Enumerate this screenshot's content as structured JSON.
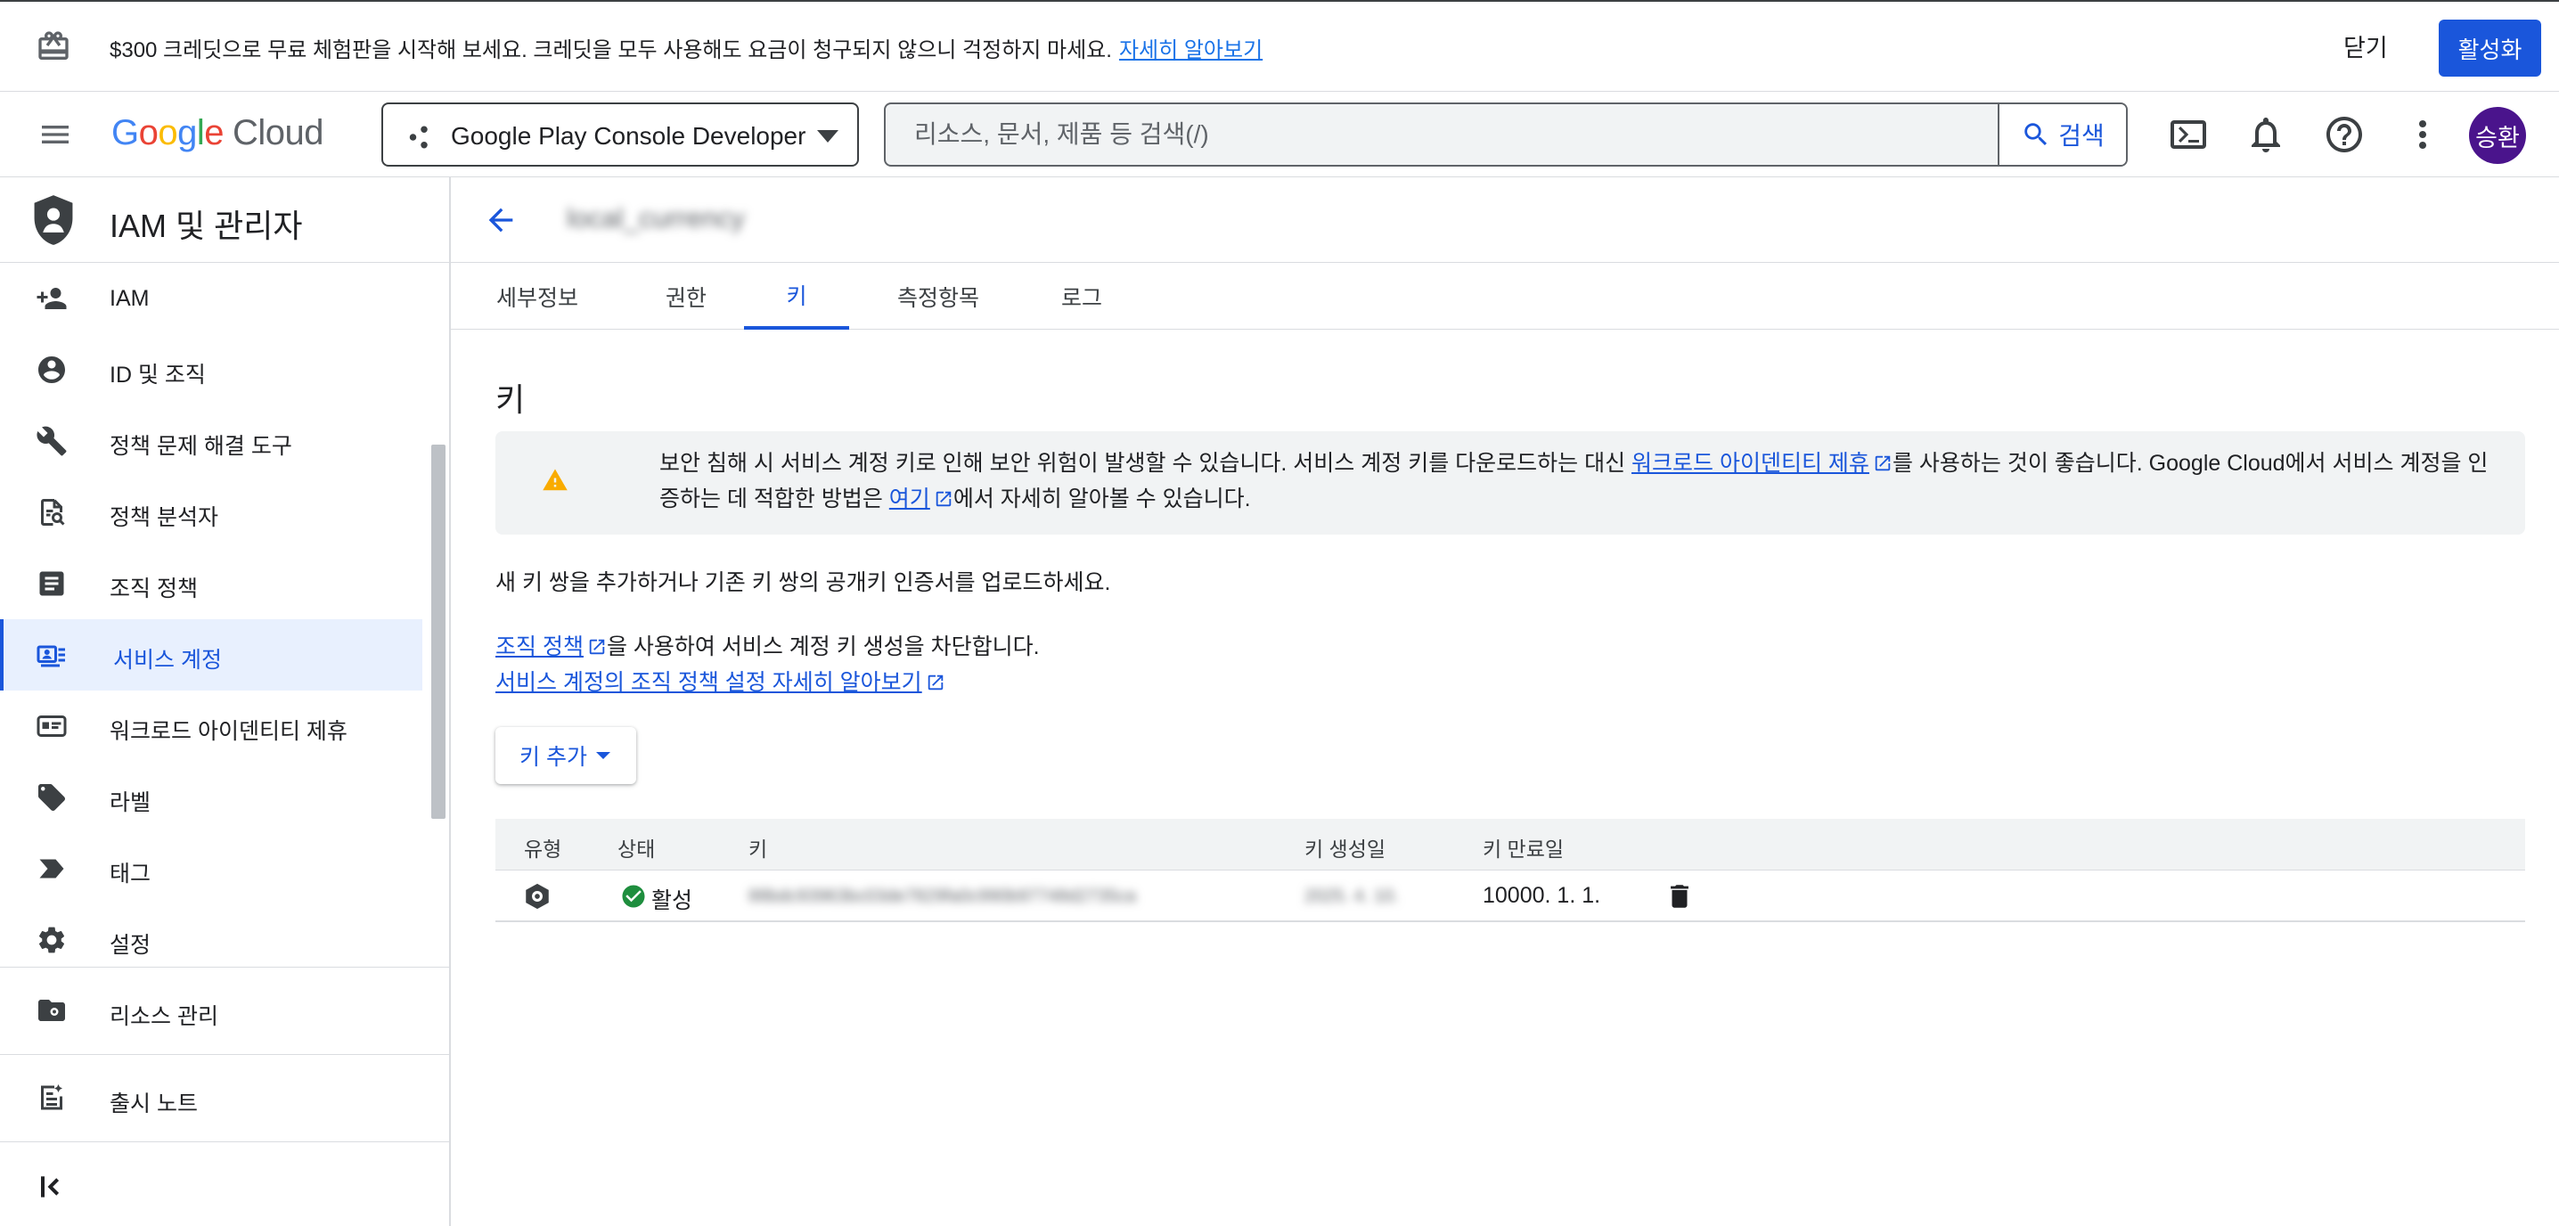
{
  "promo": {
    "message": "$300 크레딧으로 무료 체험판을 시작해 보세요. 크레딧을 모두 사용해도 요금이 청구되지 않으니 걱정하지 마세요.",
    "link": "자세히 알아보기",
    "close_label": "닫기",
    "activate_label": "활성화"
  },
  "topbar": {
    "logo": {
      "g1": "G",
      "g2": "o",
      "g3": "o",
      "g4": "g",
      "g5": "l",
      "g6": "e",
      "cloud": "Cloud"
    },
    "project_name": "Google Play Console Developer",
    "search_placeholder": "리소스, 문서, 제품 등 검색(/)",
    "search_button": "검색",
    "avatar_initials": "승환"
  },
  "sidebar": {
    "title": "IAM 및 관리자",
    "items": [
      {
        "label": "IAM",
        "icon": "person-add-icon"
      },
      {
        "label": "ID 및 조직",
        "icon": "account-circle-icon"
      },
      {
        "label": "정책 문제 해결 도구",
        "icon": "wrench-icon"
      },
      {
        "label": "정책 분석자",
        "icon": "document-search-icon"
      },
      {
        "label": "조직 정책",
        "icon": "list-alt-icon"
      },
      {
        "label": "서비스 계정",
        "icon": "service-account-icon",
        "active": true
      },
      {
        "label": "워크로드 아이덴티티 제휴",
        "icon": "id-card-icon"
      },
      {
        "label": "라벨",
        "icon": "label-icon"
      },
      {
        "label": "태그",
        "icon": "tag-arrow-icon"
      },
      {
        "label": "설정",
        "icon": "gear-icon"
      }
    ],
    "resource_manage": "리소스 관리",
    "release_notes": "출시 노트"
  },
  "main": {
    "account_name": "local_currency",
    "tabs": [
      {
        "label": "세부정보"
      },
      {
        "label": "권한"
      },
      {
        "label": "키",
        "active": true
      },
      {
        "label": "측정항목"
      },
      {
        "label": "로그"
      }
    ],
    "heading": "키",
    "warning": {
      "part1": "보안 침해 시 서비스 계정 키로 인해 보안 위험이 발생할 수 있습니다. 서비스 계정 키를 다운로드하는 대신 ",
      "link1": "워크로드 아이덴티티 제휴",
      "part2": "를 사용하는 것이 좋습니다. Google Cloud에서 서비스 계정을 인증하는 데 적합한 방법은 ",
      "link2": "여기",
      "part3": "에서 자세히 알아볼 수 있습니다."
    },
    "desc": "새 키 쌍을 추가하거나 기존 키 쌍의 공개키 인증서를 업로드하세요.",
    "org_policy_link": "조직 정책",
    "org_policy_text": "을 사용하여 서비스 계정 키 생성을 차단합니다.",
    "learn_more_link": "서비스 계정의 조직 정책 설정 자세히 알아보기",
    "add_key_label": "키 추가",
    "table": {
      "headers": [
        "유형",
        "상태",
        "키",
        "키 생성일",
        "키 만료일"
      ],
      "rows": [
        {
          "status": "활성",
          "key": "88bdc93963bc03de7829fa0c990b97748d2735ca",
          "created": "2025. 4. 10.",
          "expires": "10000. 1. 1."
        }
      ]
    }
  },
  "colors": {
    "accent": "#1a56db",
    "active_bg": "#e8f0fe",
    "warning": "#f9ab00",
    "success": "#1e8e3e"
  }
}
